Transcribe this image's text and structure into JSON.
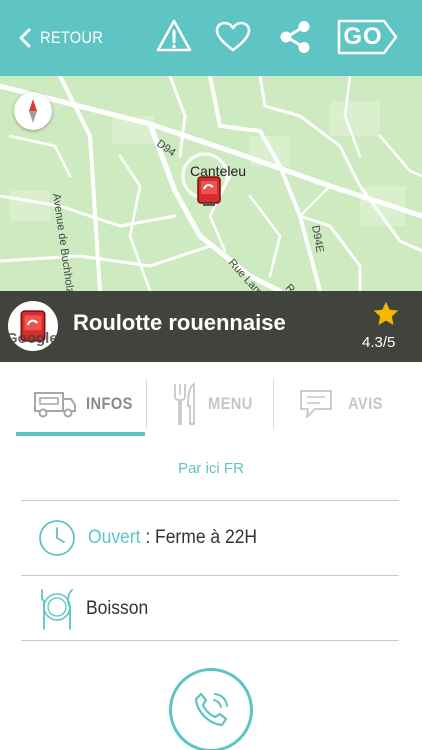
{
  "header": {
    "back_label": "RETOUR",
    "go_label": "GO",
    "icons": [
      "warning-icon",
      "heart-icon",
      "share-icon"
    ]
  },
  "map": {
    "town_label": "Canteleu",
    "road_labels": [
      "D94",
      "Avenue de Buchholz",
      "D94E",
      "Rue Lamartine",
      "Rue Molière"
    ],
    "attribution": "Google",
    "colors": {
      "land": "#cdeac0",
      "road": "#ffffff"
    }
  },
  "venue": {
    "name": "Roulotte rouennaise",
    "rating": "4.3/5"
  },
  "tabs": [
    {
      "label": "INFOS",
      "icon": "food-truck-icon",
      "active": true
    },
    {
      "label": "MENU",
      "icon": "fork-knife-icon",
      "active": false
    },
    {
      "label": "AVIS",
      "icon": "speech-bubble-icon",
      "active": false
    }
  ],
  "info": {
    "website_link": "Par ici FR",
    "status_open": "Ouvert",
    "status_detail": " : Ferme à 22H",
    "category": "Boisson"
  },
  "colors": {
    "accent": "#5ec4c4",
    "title_band": "#30342c",
    "star": "#f5b800"
  }
}
